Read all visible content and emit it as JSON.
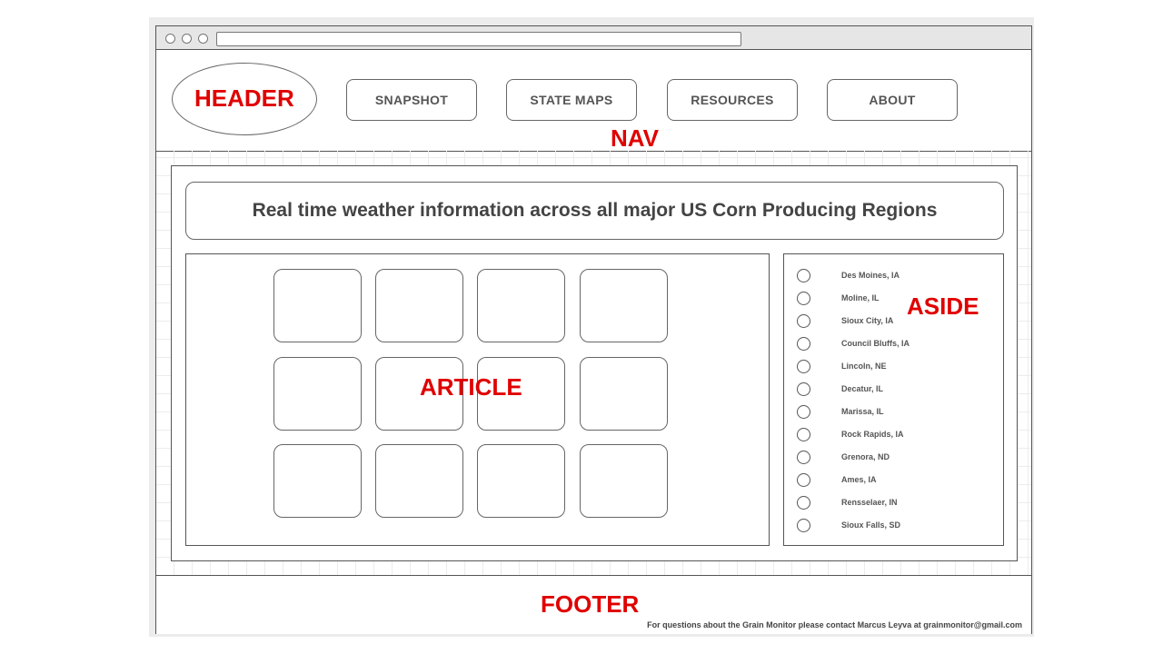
{
  "labels": {
    "header": "HEADER",
    "nav": "NAV",
    "article": "ARTICLE",
    "aside": "ASIDE",
    "footer": "FOOTER"
  },
  "nav": {
    "items": [
      "SNAPSHOT",
      "STATE MAPS",
      "RESOURCES",
      "ABOUT"
    ]
  },
  "banner": {
    "text": "Real time weather information across all major US Corn Producing Regions"
  },
  "aside": {
    "locations": [
      "Des Moines, IA",
      "Moline, IL",
      "Sioux City, IA",
      "Council Bluffs, IA",
      "Lincoln, NE",
      "Decatur, IL",
      "Marissa, IL",
      "Rock Rapids, IA",
      "Grenora, ND",
      "Ames, IA",
      "Rensselaer, IN",
      "Sioux Falls, SD"
    ]
  },
  "footer": {
    "contact": "For questions about the Grain Monitor please contact Marcus Leyva at grainmonitor@gmail.com"
  },
  "colors": {
    "annotation": "#e00000",
    "wireframe_line": "#555555"
  }
}
